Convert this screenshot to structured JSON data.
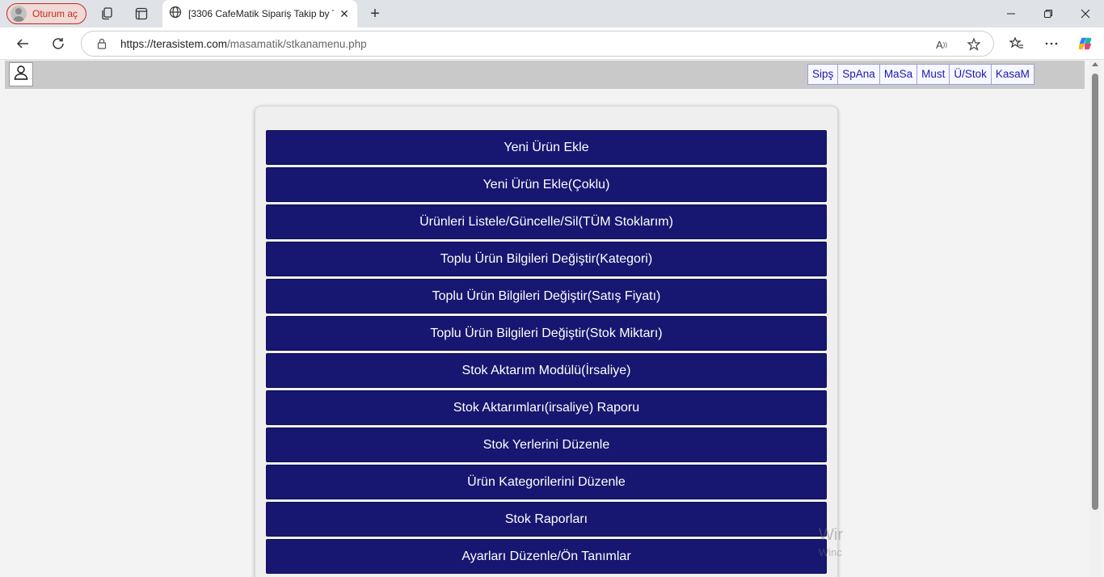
{
  "browser": {
    "profile_label": "Oturum aç",
    "tab_title": "[3306 CafeMatik Sipariş Takip by T",
    "url_host": "https://terasistem.com",
    "url_path": "/masamatik/stkanamenu.php"
  },
  "header": {
    "quick_nav": [
      "Sipş",
      "SpAna",
      "MaSa",
      "Must",
      "Ü/Stok",
      "KasaM"
    ]
  },
  "menu": {
    "items": [
      "Yeni Ürün Ekle",
      "Yeni Ürün Ekle(Çoklu)",
      "Ürünleri Listele/Güncelle/Sil(TÜM Stoklarım)",
      "Toplu Ürün Bilgileri Değiştir(Kategori)",
      "Toplu Ürün Bilgileri Değiştir(Satış Fiyatı)",
      "Toplu Ürün Bilgileri Değiştir(Stok Miktarı)",
      "Stok Aktarım Modülü(İrsaliye)",
      "Stok Aktarımları(irsaliye) Raporu",
      "Stok Yerlerini Düzenle",
      "Ürün Kategorilerini Düzenle",
      "Stok Raporları",
      "Ayarları Düzenle/Ön Tanımlar"
    ]
  },
  "watermark": {
    "line1": "Wir",
    "line2": "Winc"
  },
  "colors": {
    "button_bg": "#171771",
    "profile_accent": "#c42b1c",
    "nav_link": "#1a1ab4"
  }
}
